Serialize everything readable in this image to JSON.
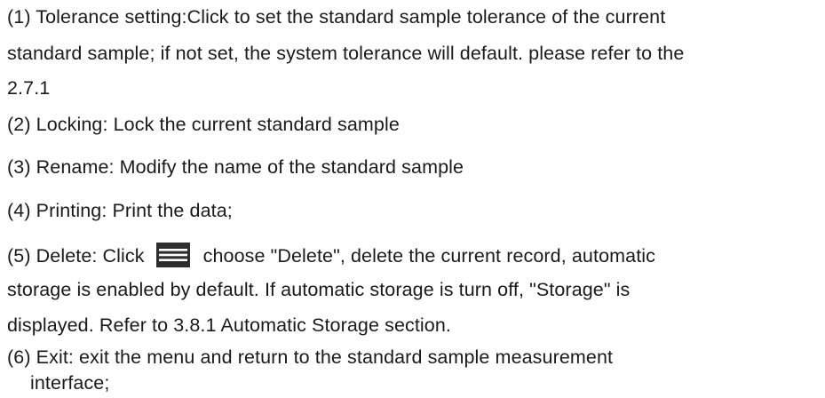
{
  "items": [
    {
      "id": "tolerance",
      "lines": [
        "(1) Tolerance setting:Click to set the standard sample tolerance of the current",
        "standard sample; if not set, the system tolerance will default. please refer to the",
        "2.7.1"
      ]
    },
    {
      "id": "locking",
      "lines": [
        "(2) Locking:  Lock the current standard sample"
      ]
    },
    {
      "id": "rename",
      "lines": [
        "(3) Rename:  Modify the name of the standard sample"
      ]
    },
    {
      "id": "printing",
      "lines": [
        "(4) Printing:  Print the data;"
      ]
    },
    {
      "id": "delete",
      "first_before_icon": "(5) Delete:  Click",
      "icon": "menu-icon",
      "first_after_icon": "choose \"Delete\",  delete the current record,  automatic",
      "lines": [
        "storage is enabled by default. If automatic storage is turn off, \"Storage\" is",
        "displayed. Refer to 3.8.1 Automatic Storage section."
      ]
    },
    {
      "id": "exit",
      "lines": [
        "(6) Exit: exit the menu and return to the standard sample measurement",
        "interface;"
      ]
    }
  ],
  "colors": {
    "text": "#1a1a1a",
    "icon": "#2e2e2e",
    "background": "#ffffff"
  }
}
